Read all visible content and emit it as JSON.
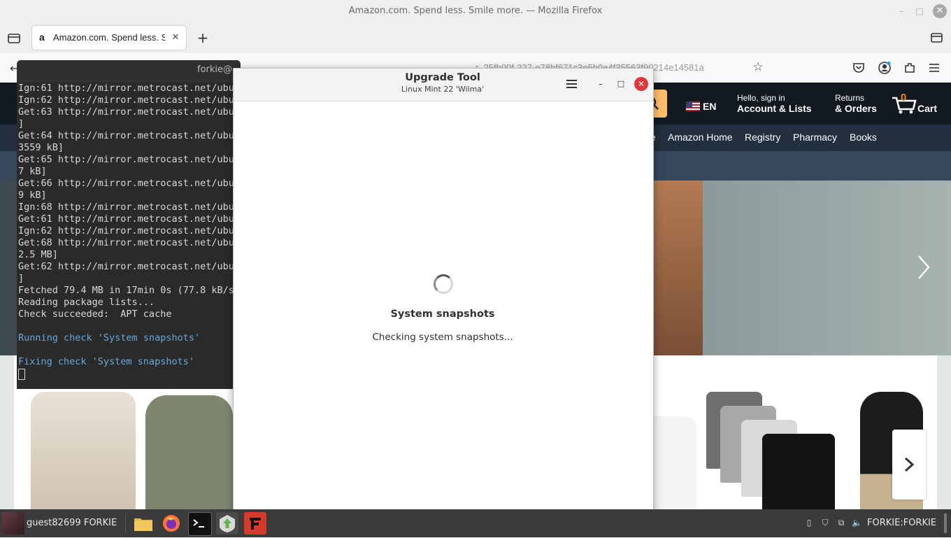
{
  "firefox": {
    "window_title": "Amazon.com. Spend less. Smile more. — Mozilla Firefox",
    "tab_label": "Amazon.com. Spend less. Sr",
    "tab_favicon": "a",
    "url_fragment": "r_25fb00f-227-e78bf671c3e5b0e4f35563f90214e14581a",
    "minimize": "–",
    "maximize": "□",
    "close": "✕"
  },
  "amazon": {
    "language": "EN",
    "account_hello": "Hello, sign in",
    "account_lists": "Account & Lists",
    "returns": "Returns",
    "orders": "& Orders",
    "cart_count": "0",
    "cart_label": "Cart",
    "nav_partial": "e",
    "nav_items": [
      "Amazon Home",
      "Registry",
      "Pharmacy",
      "Books"
    ],
    "colors": {
      "header": "#131921",
      "nav": "#232f3e",
      "search": "#febd69",
      "cart_count": "#f08804"
    }
  },
  "terminal": {
    "title": "forkie@",
    "lines": [
      "Ign:61 http://mirror.metrocast.net/ubur",
      "Ign:62 http://mirror.metrocast.net/ubur",
      "Get:63 http://mirror.metrocast.net/ubur",
      "]",
      "Get:64 http://mirror.metrocast.net/ubur",
      "3559 kB]",
      "Get:65 http://mirror.metrocast.net/ubur",
      "7 kB]",
      "Get:66 http://mirror.metrocast.net/ubur",
      "9 kB]",
      "Ign:68 http://mirror.metrocast.net/ubur",
      "Get:61 http://mirror.metrocast.net/ubur",
      "Ign:62 http://mirror.metrocast.net/ubur",
      "Get:68 http://mirror.metrocast.net/ubur",
      "2.5 MB]",
      "Get:62 http://mirror.metrocast.net/ubur",
      "]",
      "Fetched 79.4 MB in 17min 0s (77.8 kB/s",
      "Reading package lists...",
      "Check succeeded:  APT cache",
      "",
      "Running check 'System snapshots'",
      "",
      "Fixing check 'System snapshots'"
    ]
  },
  "upgrade_tool": {
    "title": "Upgrade Tool",
    "subtitle": "Linux Mint 22 'Wilma'",
    "minimize": "–",
    "maximize": "□",
    "close": "✕",
    "step_title": "System snapshots",
    "step_status": "Checking system snapshots..."
  },
  "taskbar": {
    "user_label": "guest82699 FORKIE",
    "tray_user": "FORKIE:FORKIE",
    "apps": [
      "files-icon",
      "firefox-icon",
      "terminal-icon",
      "mintupdate-icon",
      "fortigate-icon"
    ]
  }
}
